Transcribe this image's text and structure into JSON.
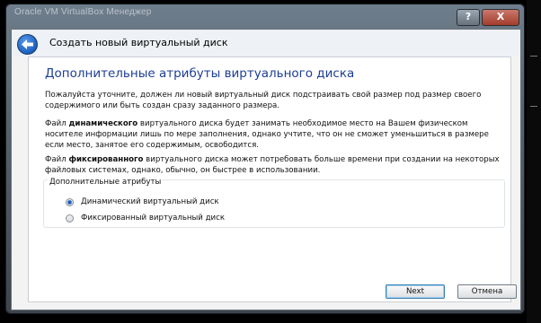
{
  "window": {
    "title": "Oracle VM VirtualBox Менеджер",
    "help_button": "?",
    "close_button": "X"
  },
  "header": {
    "title": "Создать новый виртуальный диск"
  },
  "page": {
    "title": "Дополнительные атрибуты виртуального диска",
    "paragraph1": "Пожалуйста уточните, должен ли новый виртуальный диск подстраивать свой размер под размер своего содержимого или быть создан сразу заданного размера.",
    "paragraph2": {
      "pre": "Файл ",
      "bold": "динамического",
      "post": " виртуального диска будет занимать необходимое место на Вашем физическом носителе информации лишь по мере заполнения, однако учтите, что он не сможет уменьшиться в размере если место, занятое его содержимым, освободится."
    },
    "paragraph3": {
      "pre": "Файл ",
      "bold": "фиксированного",
      "post": " виртуального диска может потребовать больше времени при создании на некоторых файловых системах, однако, обычно, он быстрее в использовании."
    },
    "group": {
      "label": "Дополнительные атрибуты",
      "options": [
        {
          "label": "Динамический виртуальный диск",
          "checked": true
        },
        {
          "label": "Фиксированный виртуальный диск",
          "checked": false
        }
      ]
    }
  },
  "buttons": {
    "next": "Next",
    "cancel": "Отмена"
  },
  "colors": {
    "title_blue": "#1c3e94",
    "accent": "#1b5fbf"
  }
}
